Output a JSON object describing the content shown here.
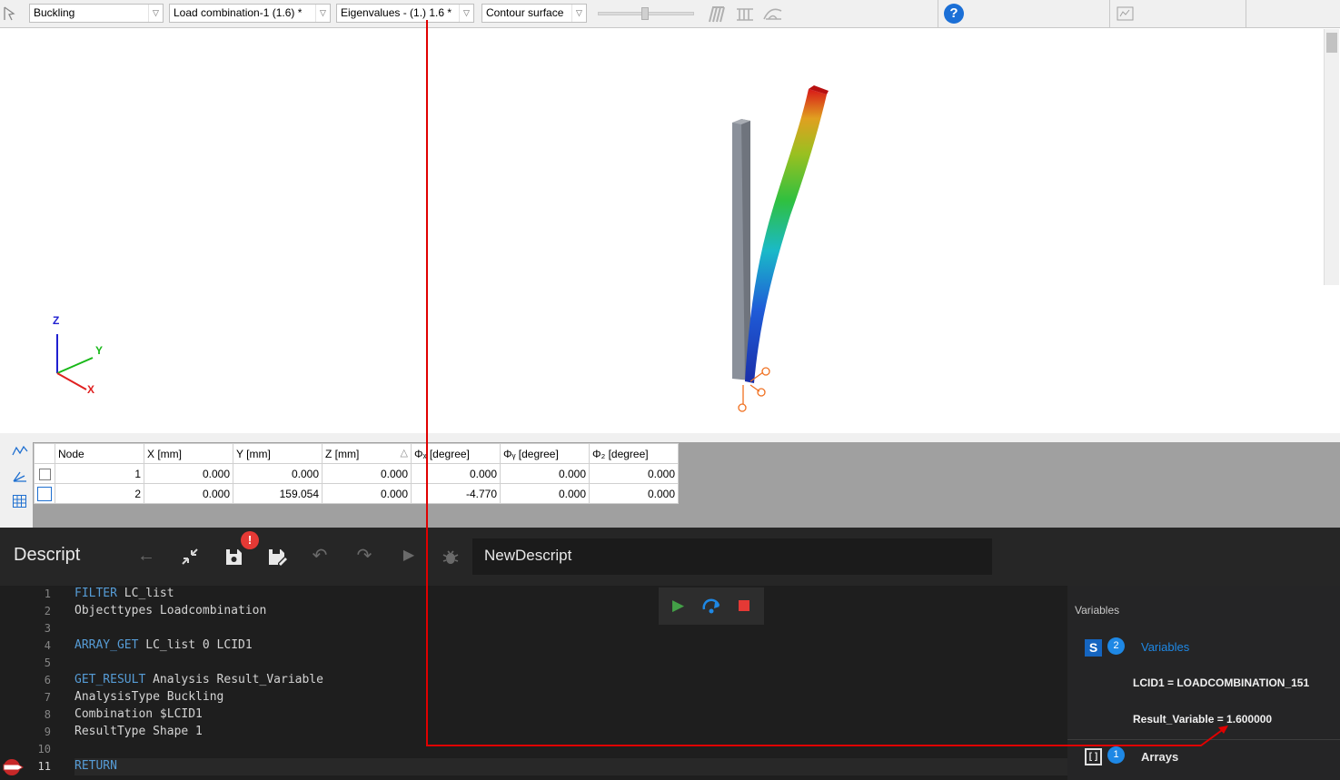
{
  "toolbar": {
    "dropdowns": [
      {
        "value": "Buckling"
      },
      {
        "value": "Load combination-1 (1.6) *"
      },
      {
        "value": "Eigenvalues - (1.)  1.6 *"
      },
      {
        "value": "Contour surface"
      }
    ],
    "help_icon": "question-circle-icon"
  },
  "viewport": {
    "axes": {
      "z": "Z",
      "y": "Y",
      "x": "X"
    },
    "colors": {
      "axis_z": "#1f1fd0",
      "axis_y": "#18b818",
      "axis_x": "#e02020"
    }
  },
  "table": {
    "columns": [
      "Node",
      "X [mm]",
      "Y [mm]",
      "Z [mm]",
      "Φₓ [degree]",
      "Φᵧ [degree]",
      "Φ₂ [degree]"
    ],
    "rows": [
      {
        "node": "1",
        "x": "0.000",
        "y": "0.000",
        "z": "0.000",
        "phix": "0.000",
        "phiy": "0.000",
        "phiz": "0.000"
      },
      {
        "node": "2",
        "x": "0.000",
        "y": "159.054",
        "z": "0.000",
        "phix": "-4.770",
        "phiy": "0.000",
        "phiz": "0.000"
      }
    ]
  },
  "descript": {
    "title": "Descript",
    "script_name": "NewDescript",
    "unsaved_badge": "!",
    "lines": [
      {
        "n": "1",
        "kw": "FILTER",
        "rest": " LC_list"
      },
      {
        "n": "2",
        "kw": "",
        "rest": "Objecttypes Loadcombination"
      },
      {
        "n": "3",
        "kw": "",
        "rest": ""
      },
      {
        "n": "4",
        "kw": "ARRAY_GET",
        "rest": " LC_list 0 LCID1"
      },
      {
        "n": "5",
        "kw": "",
        "rest": ""
      },
      {
        "n": "6",
        "kw": "GET_RESULT",
        "rest": " Analysis Result_Variable"
      },
      {
        "n": "7",
        "kw": "",
        "rest": "AnalysisType Buckling"
      },
      {
        "n": "8",
        "kw": "",
        "rest": "Combination $LCID1"
      },
      {
        "n": "9",
        "kw": "",
        "rest": "ResultType Shape 1"
      },
      {
        "n": "10",
        "kw": "",
        "rest": ""
      },
      {
        "n": "11",
        "kw": "RETURN",
        "rest": ""
      }
    ]
  },
  "variables": {
    "header": "Variables",
    "scalars_badge": "S",
    "scalars_count": "2",
    "scalars_label": "Variables",
    "items": [
      "LCID1 = LOADCOMBINATION_151",
      "Result_Variable = 1.600000"
    ],
    "arrays_badge": "[ ]",
    "arrays_count": "1",
    "arrays_label": "Arrays"
  },
  "colors": {
    "accent_blue": "#1e88e5",
    "annotation_red": "#e00000"
  }
}
